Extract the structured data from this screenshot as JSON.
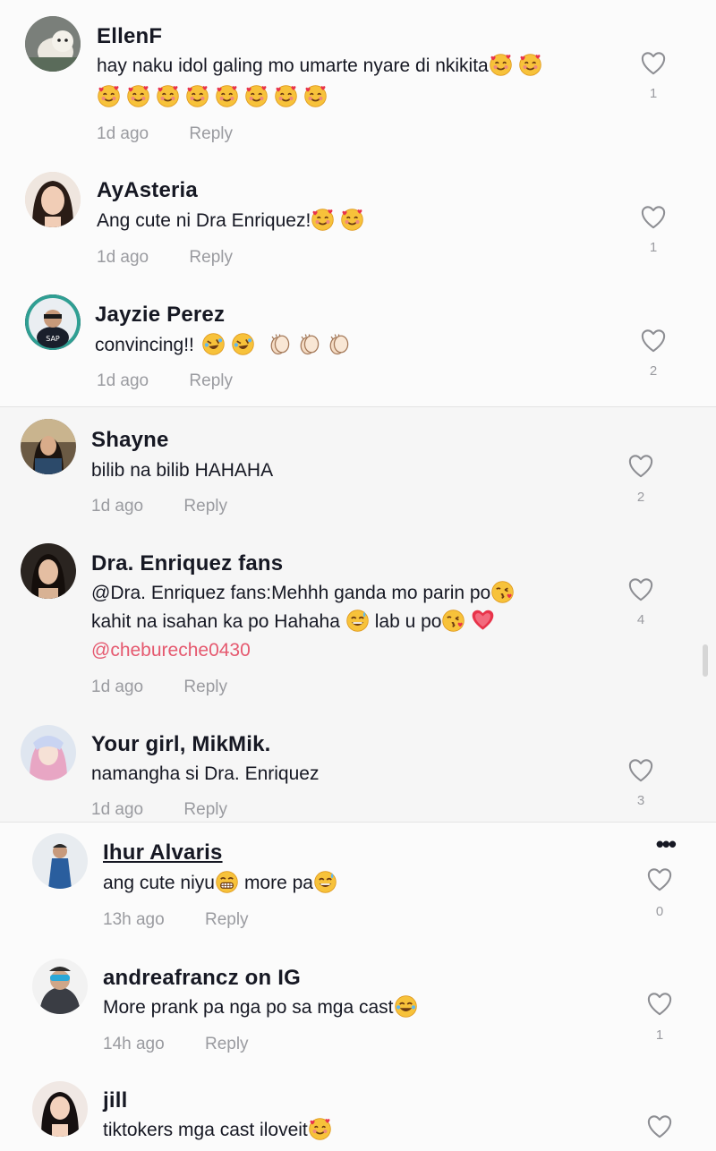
{
  "comments": [
    {
      "username": "EllenF",
      "text": "hay naku idol galing mo umarte nyare di nkikita",
      "emoji_trailing": [
        "smiling-face-with-hearts-icon",
        "smiling-face-with-hearts-icon"
      ],
      "emoji_line2": [
        "smiling-face-with-hearts-icon",
        "smiling-face-with-hearts-icon",
        "smiling-face-with-hearts-icon",
        "smiling-face-with-hearts-icon",
        "smiling-face-with-hearts-icon",
        "smiling-face-with-hearts-icon",
        "smiling-face-with-hearts-icon",
        "smiling-face-with-hearts-icon"
      ],
      "time": "1d ago",
      "reply": "Reply",
      "likes": "1"
    },
    {
      "username": "AyAsteria",
      "text": "Ang cute ni Dra Enriquez!",
      "emoji_trailing": [
        "smiling-face-with-hearts-icon",
        "smiling-face-with-hearts-icon"
      ],
      "time": "1d ago",
      "reply": "Reply",
      "likes": "1"
    },
    {
      "username": "Jayzie Perez",
      "text": "convincing!!",
      "emoji_trailing": [
        "rolling-on-floor-laughing-icon",
        "rolling-on-floor-laughing-icon",
        "clapping-hands-icon",
        "clapping-hands-icon",
        "clapping-hands-icon"
      ],
      "time": "1d ago",
      "reply": "Reply",
      "likes": "2"
    },
    {
      "username": "Shayne",
      "text": "bilib na bilib HAHAHA",
      "time": "1d ago",
      "reply": "Reply",
      "likes": "2"
    },
    {
      "username": "Dra. Enriquez fans",
      "text_line1": "@Dra. Enriquez fans:Mehhh ganda mo parin po",
      "text_line2a": "kahit na isahan ka po Hahaha",
      "text_line2b": "lab u po",
      "mention": "@chebureche0430",
      "time": "1d ago",
      "reply": "Reply",
      "likes": "4"
    },
    {
      "username": "Your girl, MikMik.",
      "text": "namangha si Dra. Enriquez",
      "time": "1d ago",
      "reply": "Reply",
      "likes": "3"
    },
    {
      "username": "Ihur Alvaris",
      "text_a": "ang cute niyu",
      "text_b": "more pa",
      "time": "13h ago",
      "reply": "Reply",
      "likes": "0",
      "more": "•••"
    },
    {
      "username": "andreafrancz on IG",
      "text": "More prank pa nga po sa mga cast",
      "time": "14h ago",
      "reply": "Reply",
      "likes": "1"
    },
    {
      "username": "jill",
      "text": "tiktokers mga cast iloveit"
    }
  ],
  "colors": {
    "username": "#161823",
    "meta": "#9a9ba0",
    "mention": "#e5596f",
    "heart_outline": "#9a9ba0"
  }
}
